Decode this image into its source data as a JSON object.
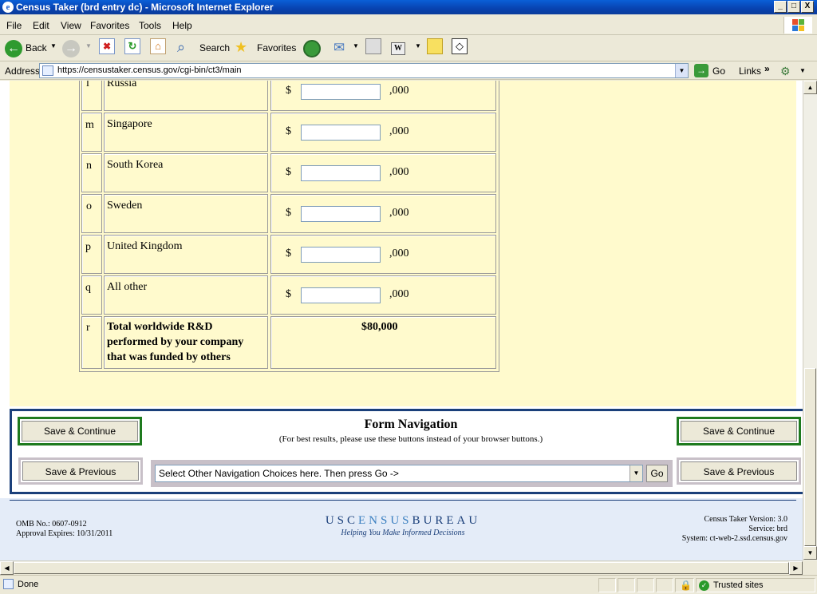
{
  "window": {
    "title": "Census Taker (brd entry dc) - Microsoft Internet Explorer",
    "controls": [
      "_",
      "□",
      "X"
    ]
  },
  "menu": [
    "File",
    "Edit",
    "View",
    "Favorites",
    "Tools",
    "Help"
  ],
  "toolbar": {
    "back": "Back",
    "search": "Search",
    "favorites": "Favorites"
  },
  "address": {
    "label": "Address",
    "url": "https://censustaker.census.gov/cgi-bin/ct3/main",
    "go": "Go",
    "links": "Links"
  },
  "rows": [
    {
      "letter": "l",
      "country": "Russia",
      "currency": "$",
      "suffix": ",000",
      "value": ""
    },
    {
      "letter": "m",
      "country": "Singapore",
      "currency": "$",
      "suffix": ",000",
      "value": ""
    },
    {
      "letter": "n",
      "country": "South Korea",
      "currency": "$",
      "suffix": ",000",
      "value": ""
    },
    {
      "letter": "o",
      "country": "Sweden",
      "currency": "$",
      "suffix": ",000",
      "value": ""
    },
    {
      "letter": "p",
      "country": "United Kingdom",
      "currency": "$",
      "suffix": ",000",
      "value": ""
    },
    {
      "letter": "q",
      "country": "All other",
      "currency": "$",
      "suffix": ",000",
      "value": ""
    }
  ],
  "total": {
    "letter": "r",
    "line1": "Total worldwide R&D",
    "line2": "performed by your company",
    "line3": "that was funded by others",
    "amount": "$80,000"
  },
  "nav": {
    "title": "Form Navigation",
    "subtitle": "(For best results, please use these buttons instead of your browser buttons.)",
    "save_continue": "Save & Continue",
    "save_previous": "Save & Previous",
    "select_text": "Select Other Navigation Choices here. Then press Go ->",
    "go": "Go"
  },
  "footer": {
    "omb": "OMB No.: 0607-0912",
    "expires": "Approval Expires: 10/31/2011",
    "logo_left": "USC",
    "logo_mid": "ENSUS",
    "logo_right": "BUREAU",
    "tagline": "Helping You Make Informed Decisions",
    "version": "Census Taker Version: 3.0",
    "service": "Service: brd",
    "system": "System: ct-web-2.ssd.census.gov"
  },
  "status": {
    "text": "Done",
    "zone": "Trusted sites"
  }
}
